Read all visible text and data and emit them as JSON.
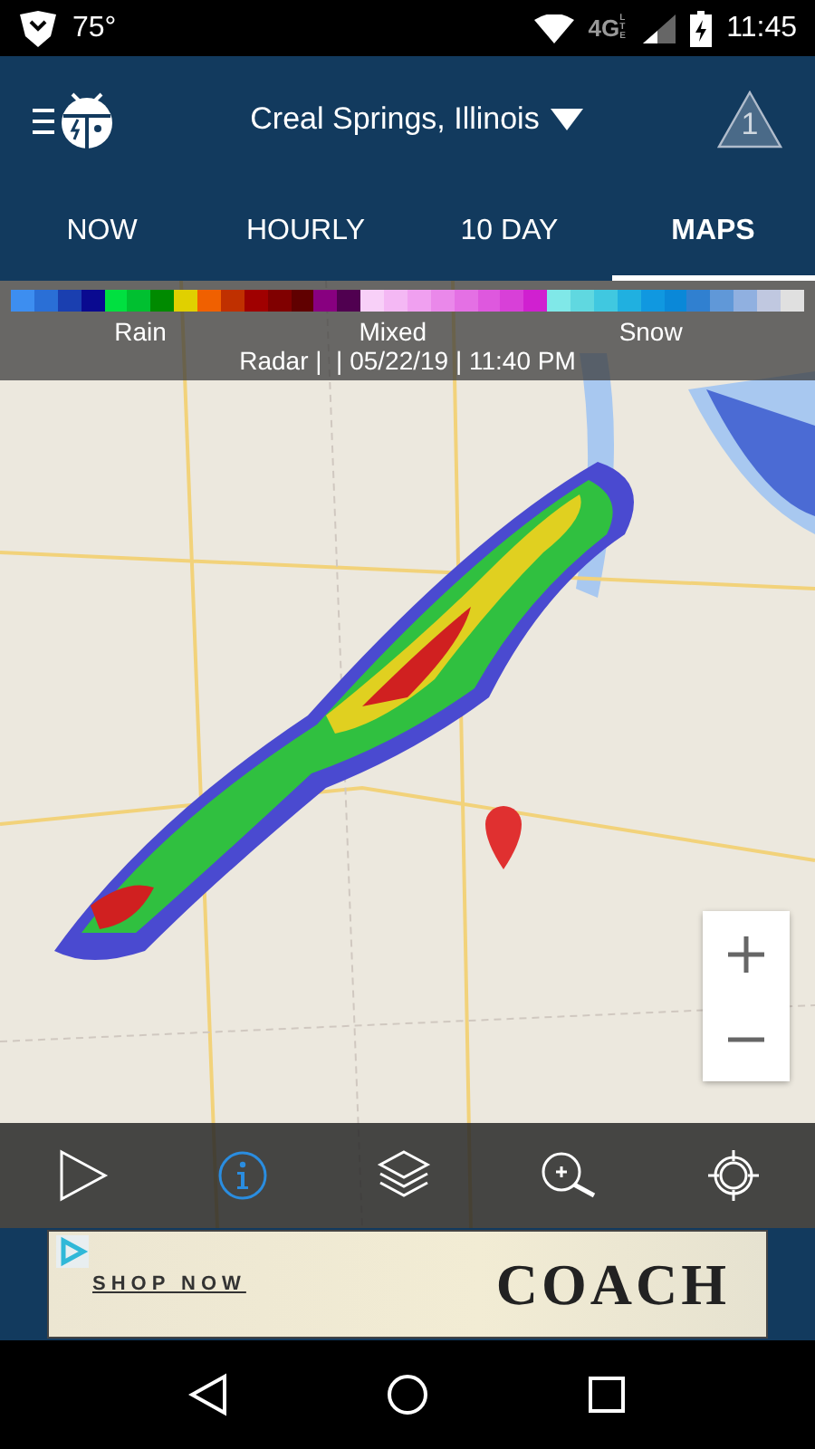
{
  "status_bar": {
    "temperature": "75°",
    "network": "4G",
    "network_sub": "LTE",
    "time": "11:45"
  },
  "header": {
    "location": "Creal Springs, Illinois",
    "alert_count": "1"
  },
  "tabs": [
    {
      "label": "NOW",
      "selected": false
    },
    {
      "label": "HOURLY",
      "selected": false
    },
    {
      "label": "10 DAY",
      "selected": false
    },
    {
      "label": "MAPS",
      "selected": true
    }
  ],
  "legend": {
    "swatches": [
      {
        "color": "#3d8ef0"
      },
      {
        "color": "#2a6fd6"
      },
      {
        "color": "#1a3fb0"
      },
      {
        "color": "#0a0a90"
      },
      {
        "color": "#00e040"
      },
      {
        "color": "#00c030"
      },
      {
        "color": "#008a00"
      },
      {
        "color": "#e0d000"
      },
      {
        "color": "#f06000"
      },
      {
        "color": "#c03000"
      },
      {
        "color": "#a00000"
      },
      {
        "color": "#800000"
      },
      {
        "color": "#600000"
      },
      {
        "color": "#880080"
      },
      {
        "color": "#500050"
      },
      {
        "color": "#f8d0f8"
      },
      {
        "color": "#f4b8f4"
      },
      {
        "color": "#f0a0f0"
      },
      {
        "color": "#ea88ea"
      },
      {
        "color": "#e470e4"
      },
      {
        "color": "#de58de"
      },
      {
        "color": "#d840d8"
      },
      {
        "color": "#d020d0"
      },
      {
        "color": "#80e8e8"
      },
      {
        "color": "#60d8e0"
      },
      {
        "color": "#40c8e0"
      },
      {
        "color": "#20b0e0"
      },
      {
        "color": "#1098e0"
      },
      {
        "color": "#0a88d8"
      },
      {
        "color": "#3080d0"
      },
      {
        "color": "#6098d8"
      },
      {
        "color": "#90b0e0"
      },
      {
        "color": "#c0c8e0"
      },
      {
        "color": "#e0e0e0"
      }
    ],
    "labels": [
      "Rain",
      "Mixed",
      "Snow"
    ],
    "caption": "Radar |  | 05/22/19 | 11:40 PM"
  },
  "toolbar": [
    {
      "kind": "play",
      "selected": false
    },
    {
      "kind": "info",
      "selected": true
    },
    {
      "kind": "layers",
      "selected": false
    },
    {
      "kind": "zoom",
      "selected": false
    },
    {
      "kind": "locate",
      "selected": false
    }
  ],
  "ad": {
    "link": "SHOP NOW",
    "brand": "COACH"
  }
}
